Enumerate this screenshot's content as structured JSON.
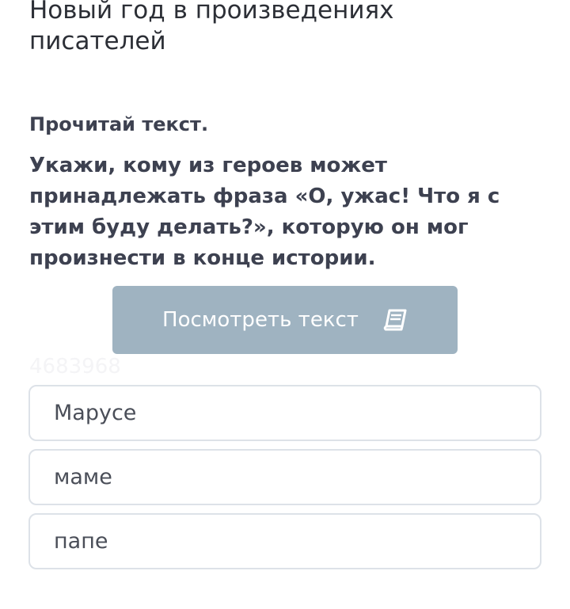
{
  "header": {
    "title": "Новый год в произведениях писателей"
  },
  "task": {
    "instruction": "Прочитай текст.",
    "question": "Укажи, кому из героев может принадлежать фраза «О, ужас! Что я с этим буду делать?», которую он мог произнести в конце истории.",
    "view_text_label": "Посмотреть текст",
    "view_text_icon": "book-icon",
    "task_id": "4683968"
  },
  "options": [
    {
      "label": "Марусе"
    },
    {
      "label": "маме"
    },
    {
      "label": "папе"
    }
  ],
  "colors": {
    "button_bg": "#9fb3c1",
    "option_border": "#dde2e8",
    "text": "#3d4150"
  }
}
